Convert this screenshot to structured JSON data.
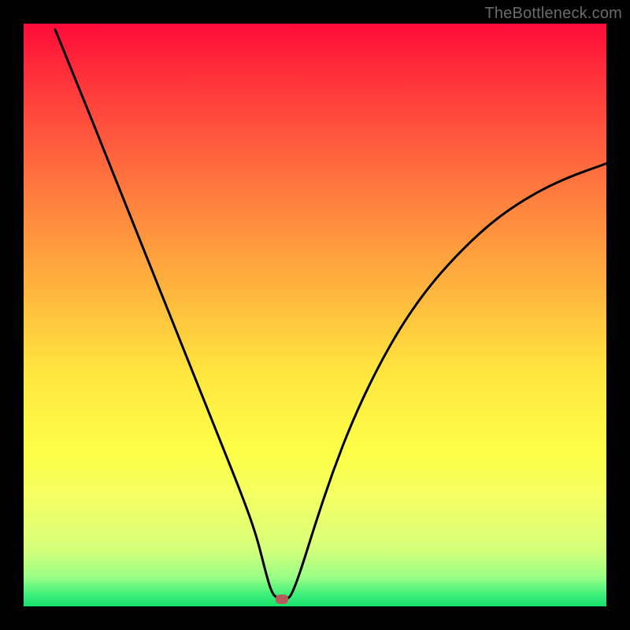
{
  "watermark": "TheBottleneck.com",
  "chart_data": {
    "type": "line",
    "title": "",
    "xlabel": "",
    "ylabel": "",
    "xlim": [
      0,
      100
    ],
    "ylim": [
      0,
      100
    ],
    "grid": false,
    "curve_points": [
      {
        "x": 5.4,
        "y": 99.0
      },
      {
        "x": 9.5,
        "y": 89.0
      },
      {
        "x": 13.5,
        "y": 79.0
      },
      {
        "x": 17.5,
        "y": 69.0
      },
      {
        "x": 21.5,
        "y": 59.0
      },
      {
        "x": 25.5,
        "y": 49.0
      },
      {
        "x": 29.5,
        "y": 39.0
      },
      {
        "x": 33.5,
        "y": 29.0
      },
      {
        "x": 37.5,
        "y": 19.0
      },
      {
        "x": 40.0,
        "y": 12.0
      },
      {
        "x": 41.5,
        "y": 6.0
      },
      {
        "x": 42.5,
        "y": 2.5
      },
      {
        "x": 43.5,
        "y": 1.3
      },
      {
        "x": 45.2,
        "y": 1.2
      },
      {
        "x": 46.0,
        "y": 2.0
      },
      {
        "x": 47.5,
        "y": 6.0
      },
      {
        "x": 50.0,
        "y": 14.0
      },
      {
        "x": 53.0,
        "y": 23.0
      },
      {
        "x": 56.5,
        "y": 32.0
      },
      {
        "x": 60.5,
        "y": 40.5
      },
      {
        "x": 65.0,
        "y": 48.5
      },
      {
        "x": 70.0,
        "y": 55.5
      },
      {
        "x": 75.5,
        "y": 61.5
      },
      {
        "x": 81.0,
        "y": 66.5
      },
      {
        "x": 87.0,
        "y": 70.5
      },
      {
        "x": 93.0,
        "y": 73.5
      },
      {
        "x": 100.0,
        "y": 76.0
      }
    ],
    "marker": {
      "x": 44.3,
      "y": 1.2,
      "color": "#b85a5a"
    },
    "gradient_colors": {
      "top": "#ff0b3a",
      "middle": "#ffe63e",
      "bottom": "#18e06c"
    }
  }
}
